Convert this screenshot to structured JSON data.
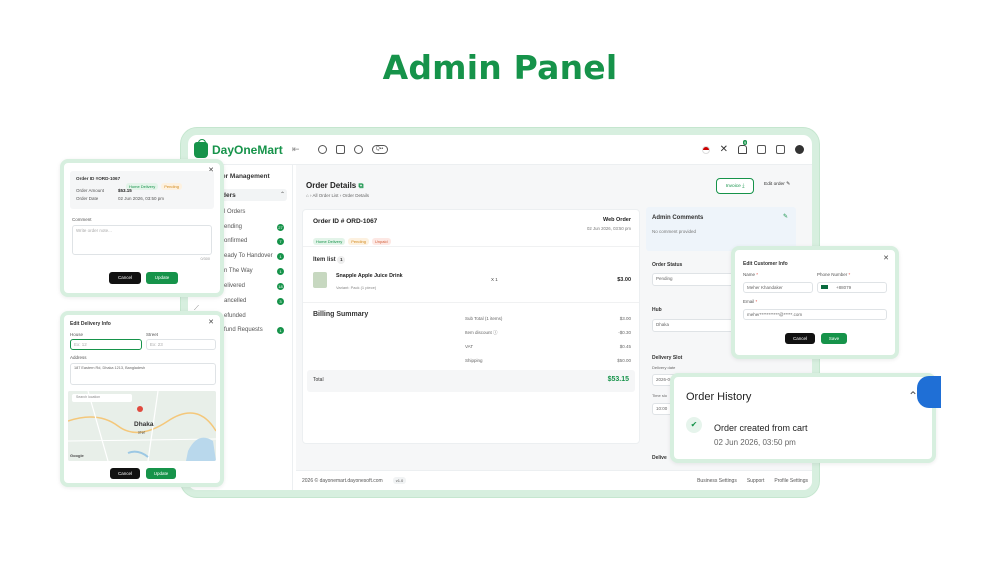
{
  "hero": {
    "title": "Admin Panel"
  },
  "brand": {
    "name": "DayOneMart"
  },
  "topbar": {
    "pill_label": "Q••"
  },
  "sidebar": {
    "section": "der Management",
    "group": "ders",
    "items": [
      {
        "label": "l Orders",
        "count": ""
      },
      {
        "label": "ending",
        "count": "27"
      },
      {
        "label": "onfirmed",
        "count": "7"
      },
      {
        "label": "eady To Handover",
        "count": "1"
      },
      {
        "label": "n The Way",
        "count": "1"
      },
      {
        "label": "elivered",
        "count": "18"
      },
      {
        "label": "ancelled",
        "count": "3"
      },
      {
        "label": "efunded",
        "count": ""
      },
      {
        "label": "fund Requests",
        "count": "1"
      }
    ]
  },
  "page": {
    "title": "Order Details",
    "breadcrumb": [
      "All Order List",
      "Order Details"
    ],
    "invoice_label": "Invoice",
    "edit_label": "Edit order"
  },
  "order": {
    "id": "Order ID # ORD-1067",
    "channel": "Web Order",
    "date": "02 Jun 2026, 03:50 pm",
    "tags": [
      "Home Delivery",
      "Pending",
      "Unpaid"
    ],
    "item_list_label": "Item list",
    "item_count": "1",
    "item": {
      "name": "Snapple Apple Juice Drink",
      "variant": "Variant: Pack (1 piece)",
      "qty": "X 1",
      "price": "$3.00"
    }
  },
  "billing": {
    "title": "Billing Summary",
    "rows": [
      {
        "label": "Sub Total (1 items)",
        "value": "$3.00"
      },
      {
        "label": "Item discount",
        "value": "-$0.30"
      },
      {
        "label": "VAT",
        "value": "$0.45"
      },
      {
        "label": "Shipping",
        "value": "$50.00"
      }
    ],
    "total_label": "Total",
    "total_value": "$53.15"
  },
  "right_panel": {
    "comments_title": "Admin Comments",
    "comments_empty": "No comment provided",
    "status_label": "Order Status",
    "status_value": "Pending",
    "hub_label": "Hub",
    "hub_value": "Dhaka",
    "slot_label": "Delivery Slot",
    "slot_date_label": "Delivery date",
    "slot_date_value": "2026-06-03",
    "slot_time_label": "Time slo",
    "slot_time_value": "10:00",
    "deliver_label": "Delive"
  },
  "footer": {
    "copyright": "2026 © dayonemart.dayonesoft.com",
    "version": "v1.0",
    "links": [
      "Business Settings",
      "Support",
      "Profile Settings"
    ]
  },
  "status_popup": {
    "order_id": "Order ID #ORD-1067",
    "tags": [
      "Home Delivery",
      "Pending"
    ],
    "amount_label": "Order Amount",
    "amount_value": "$53.15",
    "date_label": "Order Date",
    "date_value": "02 Jun 2026, 03:50 pm",
    "comment_label": "Comment",
    "comment_placeholder": "Write order note...",
    "char_count": "0/300",
    "cancel": "Cancel",
    "update": "Update"
  },
  "delivery_popup": {
    "title": "Edit Delivery Info",
    "house_label": "House",
    "house_placeholder": "Ex: 12",
    "street_label": "Street",
    "street_placeholder": "Ex: 23",
    "address_label": "Address",
    "address_value": "187 Eastern Rd, Dhaka 1213, Bangladesh",
    "map_search": "Search location",
    "map_city": "Dhaka",
    "map_sub": "ঢাকা",
    "google": "Google",
    "cancel": "Cancel",
    "update": "Update"
  },
  "customer_popup": {
    "title": "Edit Customer Info",
    "name_label": "Name",
    "name_value": "Meher Khandaker",
    "phone_label": "Phone Number",
    "phone_code": "+88079",
    "email_label": "Email",
    "email_value": "meher***********@*****.com",
    "cancel": "Cancel",
    "save": "Save"
  },
  "history": {
    "title": "Order History",
    "event": "Order created from cart",
    "event_time": "02 Jun 2026, 03:50 pm"
  },
  "colors": {
    "accent": "#16934a",
    "frame": "#d7efdf"
  }
}
